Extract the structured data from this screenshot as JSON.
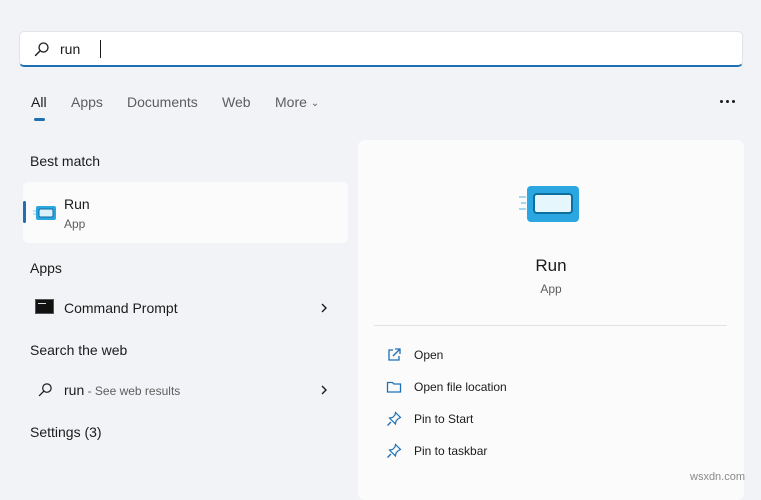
{
  "search": {
    "query": "run"
  },
  "tabs": [
    {
      "label": "All"
    },
    {
      "label": "Apps"
    },
    {
      "label": "Documents"
    },
    {
      "label": "Web"
    },
    {
      "label": "More"
    }
  ],
  "sections": {
    "best_match": "Best match",
    "apps": "Apps",
    "search_web": "Search the web",
    "settings": "Settings (3)"
  },
  "best_match": {
    "title": "Run",
    "subtitle": "App"
  },
  "apps": [
    {
      "label": "Command Prompt"
    }
  ],
  "web": {
    "query": "run",
    "suffix": " - See web results"
  },
  "detail": {
    "name": "Run",
    "type": "App",
    "actions": [
      {
        "label": "Open",
        "icon": "open-external-icon"
      },
      {
        "label": "Open file location",
        "icon": "folder-icon"
      },
      {
        "label": "Pin to Start",
        "icon": "pin-icon"
      },
      {
        "label": "Pin to taskbar",
        "icon": "pin-icon"
      }
    ]
  },
  "watermark": "wsxdn.com",
  "colors": {
    "accent": "#1f6fb2",
    "run_icon": "#2aa6e0"
  }
}
